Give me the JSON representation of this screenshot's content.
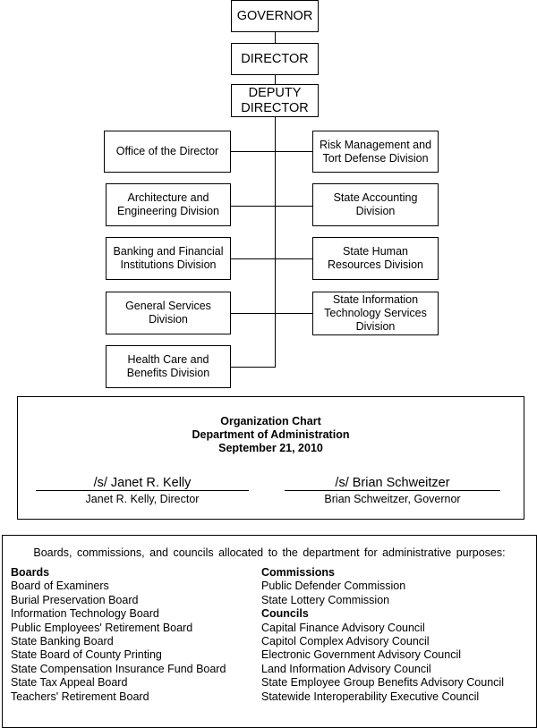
{
  "chart": {
    "top": [
      "GOVERNOR",
      "DIRECTOR",
      "DEPUTY DIRECTOR"
    ],
    "left": [
      "Office of the Director",
      "Architecture and Engineering Division",
      "Banking and Financial Institutions Division",
      "General Services Division",
      "Health Care and Benefits Division"
    ],
    "right": [
      "Risk Management and Tort Defense Division",
      "State Accounting Division",
      "State Human Resources Division",
      "State Information Technology Services Division"
    ]
  },
  "signature": {
    "title1": "Organization Chart",
    "title2": "Department of Administration",
    "title3": "September 21, 2010",
    "left_sig": "/s/ Janet R. Kelly",
    "left_role": "Janet R. Kelly, Director",
    "right_sig": "/s/ Brian Schweitzer",
    "right_role": "Brian Schweitzer, Governor"
  },
  "allocated": {
    "intro": "Boards, commissions, and councils allocated to the department for administrative purposes:",
    "boards_heading": "Boards",
    "boards": [
      "Board of Examiners",
      "Burial Preservation Board",
      "Information Technology Board",
      "Public Employees' Retirement Board",
      "State Banking Board",
      "State Board of County Printing",
      "State Compensation Insurance Fund Board",
      "State Tax Appeal Board",
      "Teachers' Retirement Board"
    ],
    "commissions_heading": "Commissions",
    "commissions": [
      "Public Defender Commission",
      "State Lottery Commission"
    ],
    "councils_heading": "Councils",
    "councils": [
      "Capital Finance Advisory Council",
      "Capitol Complex Advisory Council",
      "Electronic Government Advisory Council",
      "Land Information Advisory Council",
      "State Employee Group Benefits Advisory Council",
      "Statewide Interoperability Executive Council"
    ]
  }
}
